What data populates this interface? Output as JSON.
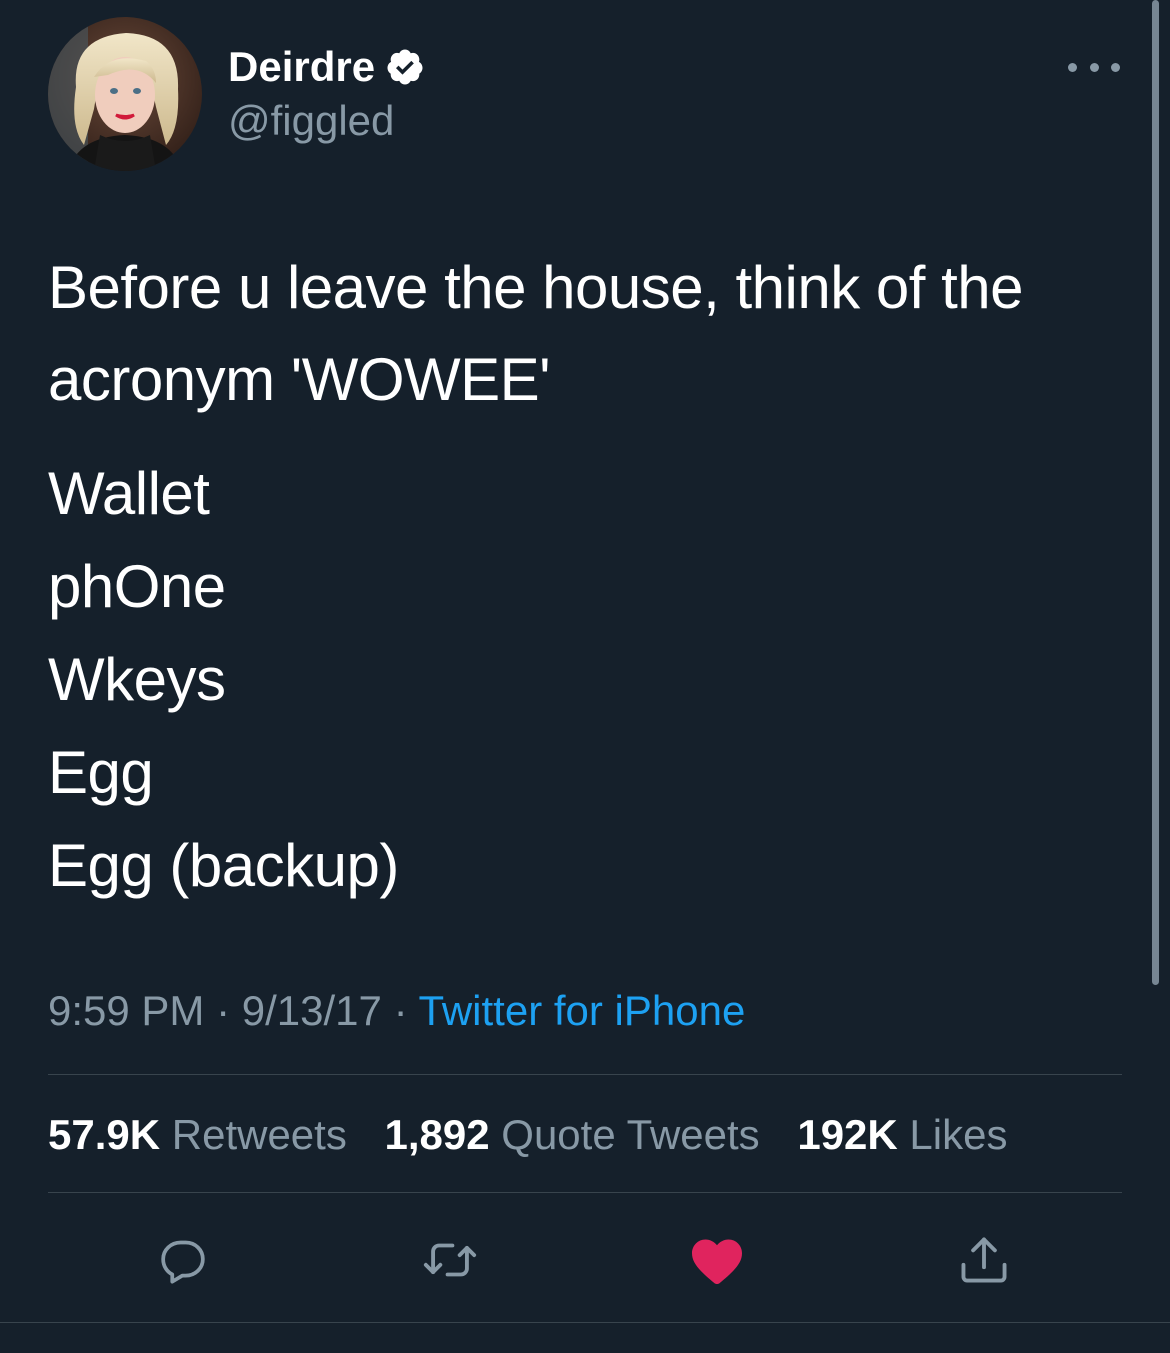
{
  "author": {
    "name": "Deirdre",
    "handle": "@figgled",
    "verified": true,
    "avatar": "profile-photo"
  },
  "tweet": {
    "text": "Before u leave the house, think of the acronym 'WOWEE'",
    "list": [
      "Wallet",
      "phOne",
      "Wkeys",
      "Egg",
      "Egg (backup)"
    ],
    "time": "9:59 PM",
    "separator": "·",
    "date": "9/13/17",
    "source": "Twitter for iPhone"
  },
  "stats": {
    "retweets_count": "57.9K",
    "retweets_label": "Retweets",
    "quotes_count": "1,892",
    "quotes_label": "Quote Tweets",
    "likes_count": "192K",
    "likes_label": "Likes"
  },
  "actions": {
    "reply_icon": "speech-bubble",
    "retweet_icon": "retweet-arrows",
    "like_icon": "heart",
    "share_icon": "share-upload"
  },
  "colors": {
    "background": "#15202b",
    "text": "#ffffff",
    "secondary": "#8899a6",
    "link": "#1da1f2",
    "liked": "#e0245e",
    "divider": "#38444d"
  }
}
